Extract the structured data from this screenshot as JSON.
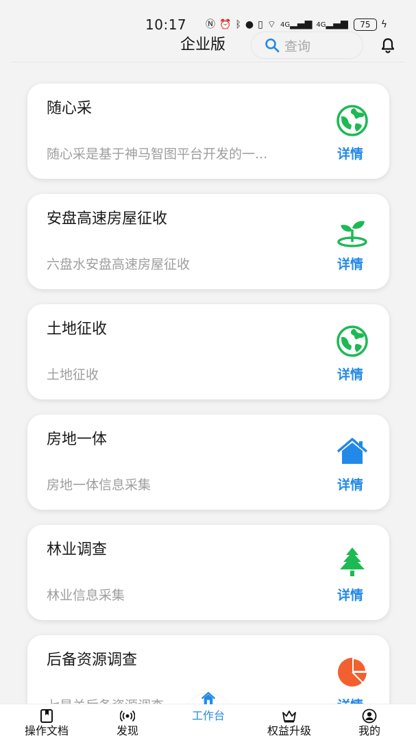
{
  "status_bar": {
    "time": "10:17",
    "network_1": "4G",
    "network_2": "4G",
    "battery": "75"
  },
  "header": {
    "title": "企业版",
    "search_placeholder": "查询"
  },
  "colors": {
    "accent": "#2389e8",
    "green": "#1db954",
    "orange": "#f2602f"
  },
  "projects": [
    {
      "title": "随心采",
      "desc": "随心采是基于神马智图平台开发的一...",
      "detail": "详情",
      "icon": "globe-icon"
    },
    {
      "title": "安盘高速房屋征收",
      "desc": "六盘水安盘高速房屋征收",
      "detail": "详情",
      "icon": "sprout-icon"
    },
    {
      "title": "土地征收",
      "desc": "土地征收",
      "detail": "详情",
      "icon": "globe-icon"
    },
    {
      "title": "房地一体",
      "desc": "房地一体信息采集",
      "detail": "详情",
      "icon": "house-icon"
    },
    {
      "title": "林业调查",
      "desc": "林业信息采集",
      "detail": "详情",
      "icon": "tree-icon"
    },
    {
      "title": "后备资源调查",
      "desc": "七星关后备资源调查",
      "detail": "详情",
      "icon": "pie-chart-icon"
    }
  ],
  "tabs": [
    {
      "label": "操作文档",
      "icon": "book-icon"
    },
    {
      "label": "发现",
      "icon": "broadcast-icon"
    },
    {
      "label": "工作台",
      "icon": "home-icon"
    },
    {
      "label": "权益升级",
      "icon": "crown-icon"
    },
    {
      "label": "我的",
      "icon": "user-icon"
    }
  ]
}
